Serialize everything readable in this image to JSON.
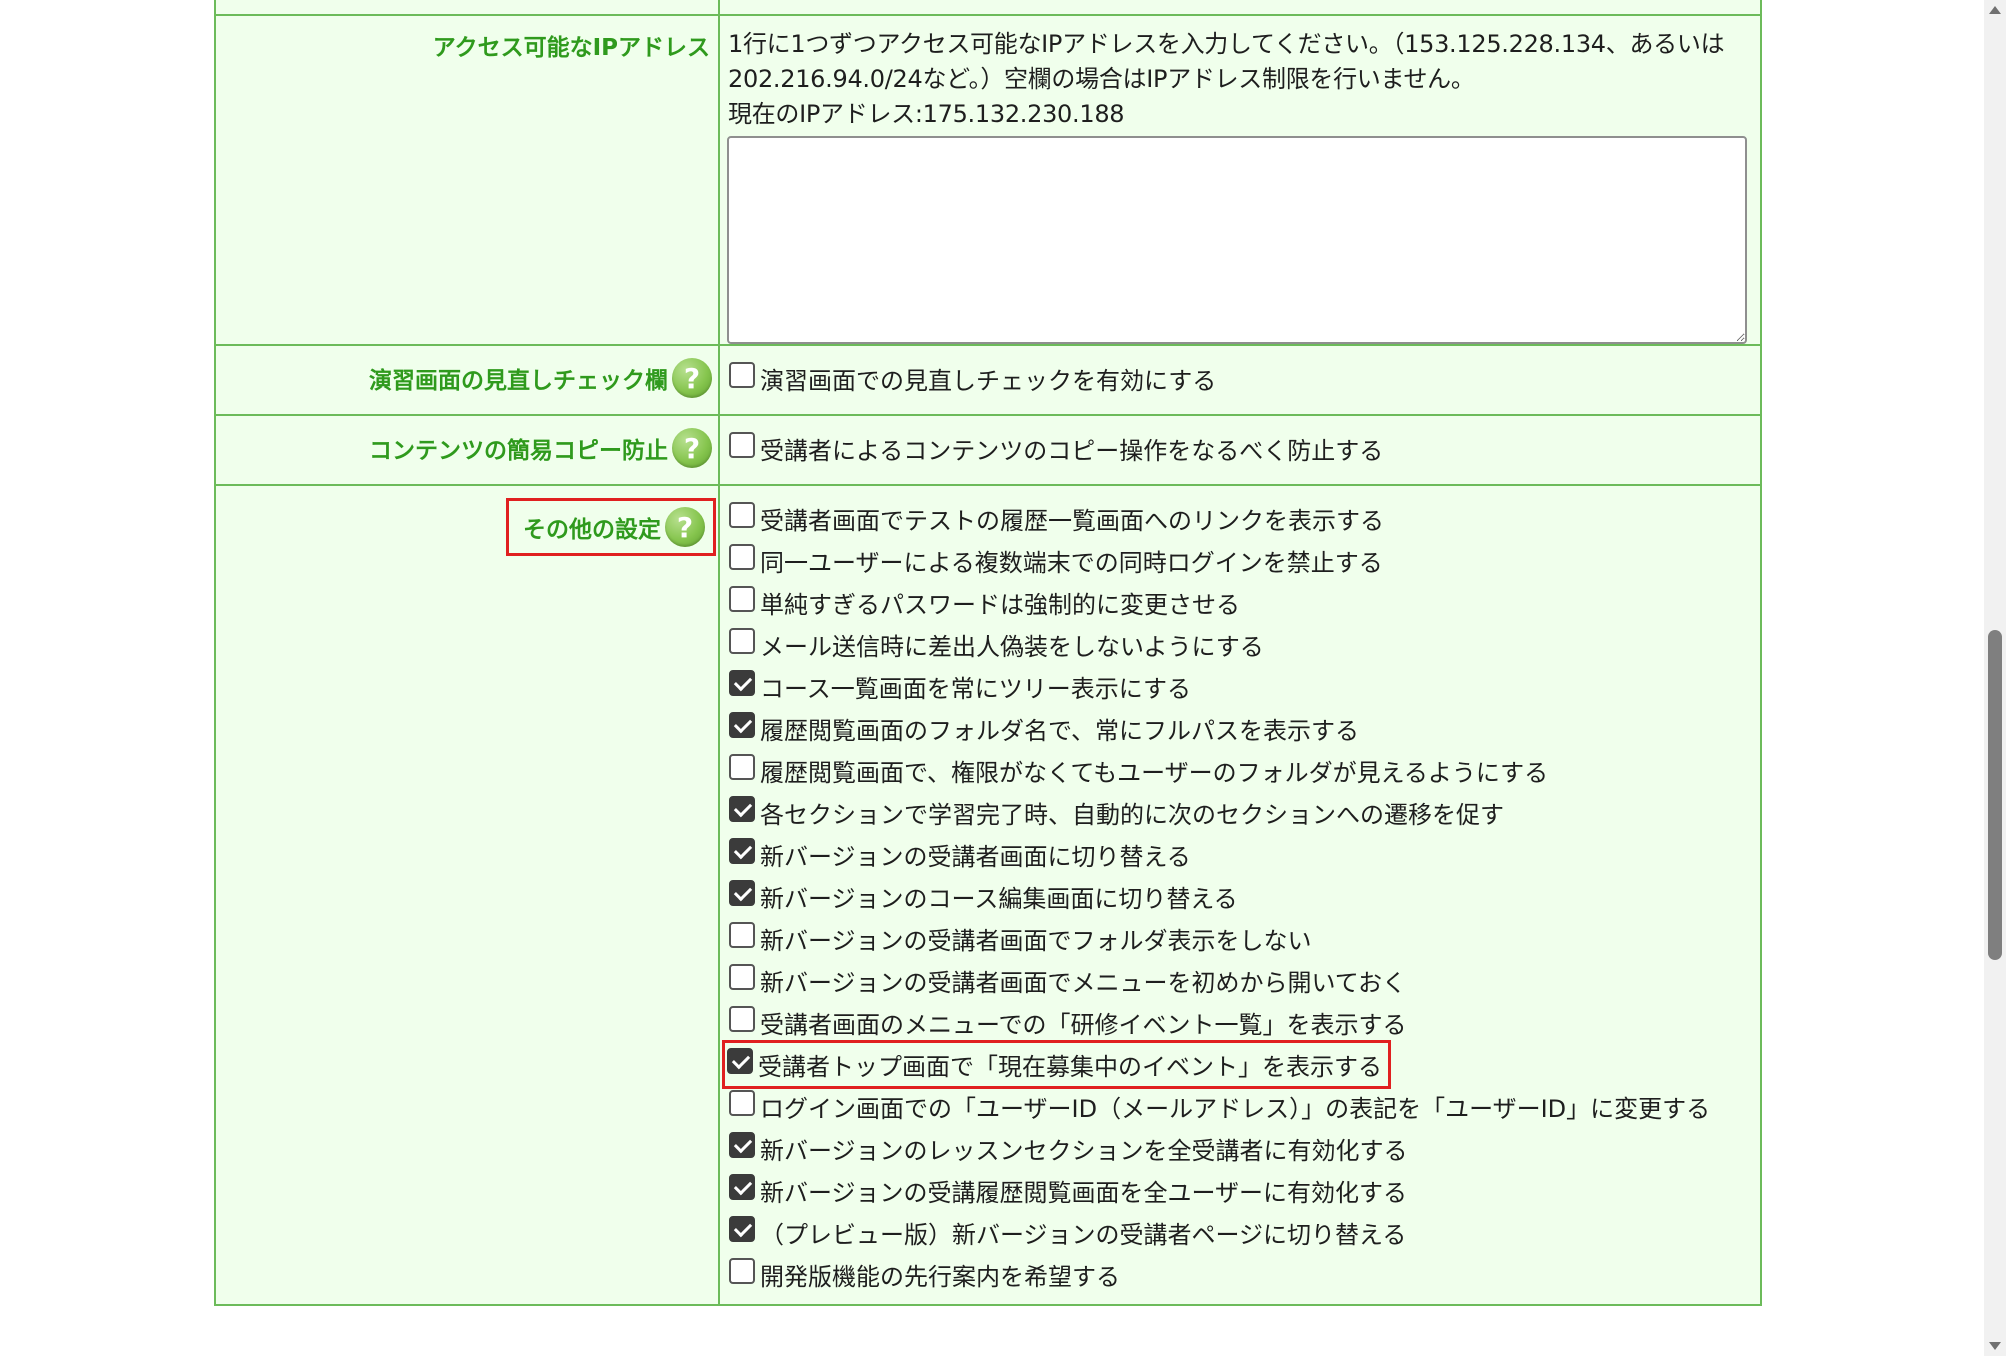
{
  "ip_row": {
    "label": "アクセス可能なIPアドレス",
    "desc_line1": "1行に1つずつアクセス可能なIPアドレスを入力してください。（153.125.228.134、あるいは",
    "desc_line2": "202.216.94.0/24など。）空欄の場合はIPアドレス制限を行いません。",
    "current_ip": "現在のIPアドレス:175.132.230.188",
    "textarea_value": ""
  },
  "review_row": {
    "label": "演習画面の見直しチェック欄",
    "help_icon": "?",
    "options": [
      {
        "label": "演習画面での見直しチェックを有効にする",
        "checked": false
      }
    ]
  },
  "copy_row": {
    "label": "コンテンツの簡易コピー防止",
    "help_icon": "?",
    "options": [
      {
        "label": "受講者によるコンテンツのコピー操作をなるべく防止する",
        "checked": false
      }
    ]
  },
  "other_row": {
    "label": "その他の設定",
    "help_icon": "?",
    "options": [
      {
        "label": "受講者画面でテストの履歴一覧画面へのリンクを表示する",
        "checked": false
      },
      {
        "label": "同一ユーザーによる複数端末での同時ログインを禁止する",
        "checked": false
      },
      {
        "label": "単純すぎるパスワードは強制的に変更させる",
        "checked": false
      },
      {
        "label": "メール送信時に差出人偽装をしないようにする",
        "checked": false
      },
      {
        "label": "コース一覧画面を常にツリー表示にする",
        "checked": true
      },
      {
        "label": "履歴閲覧画面のフォルダ名で、常にフルパスを表示する",
        "checked": true
      },
      {
        "label": "履歴閲覧画面で、権限がなくてもユーザーのフォルダが見えるようにする",
        "checked": false
      },
      {
        "label": "各セクションで学習完了時、自動的に次のセクションへの遷移を促す",
        "checked": true
      },
      {
        "label": "新バージョンの受講者画面に切り替える",
        "checked": true
      },
      {
        "label": "新バージョンのコース編集画面に切り替える",
        "checked": true
      },
      {
        "label": "新バージョンの受講者画面でフォルダ表示をしない",
        "checked": false
      },
      {
        "label": "新バージョンの受講者画面でメニューを初めから開いておく",
        "checked": false
      },
      {
        "label": "受講者画面のメニューでの「研修イベント一覧」を表示する",
        "checked": false
      },
      {
        "label": "受講者トップ画面で「現在募集中のイベント」を表示する",
        "checked": true
      },
      {
        "label": "ログイン画面での「ユーザーID（メールアドレス）」の表記を「ユーザーID」に変更する",
        "checked": false
      },
      {
        "label": "新バージョンのレッスンセクションを全受講者に有効化する",
        "checked": true
      },
      {
        "label": "新バージョンの受講履歴閲覧画面を全ユーザーに有効化する",
        "checked": true
      },
      {
        "label": "（プレビュー版）新バージョンの受講者ページに切り替える",
        "checked": true
      },
      {
        "label": "開発版機能の先行案内を希望する",
        "checked": false
      }
    ]
  },
  "colors": {
    "border": "#6cbb5a",
    "cell_bg": "#f0ffec",
    "label_text": "#2f9a1d",
    "highlight": "#e02020"
  }
}
